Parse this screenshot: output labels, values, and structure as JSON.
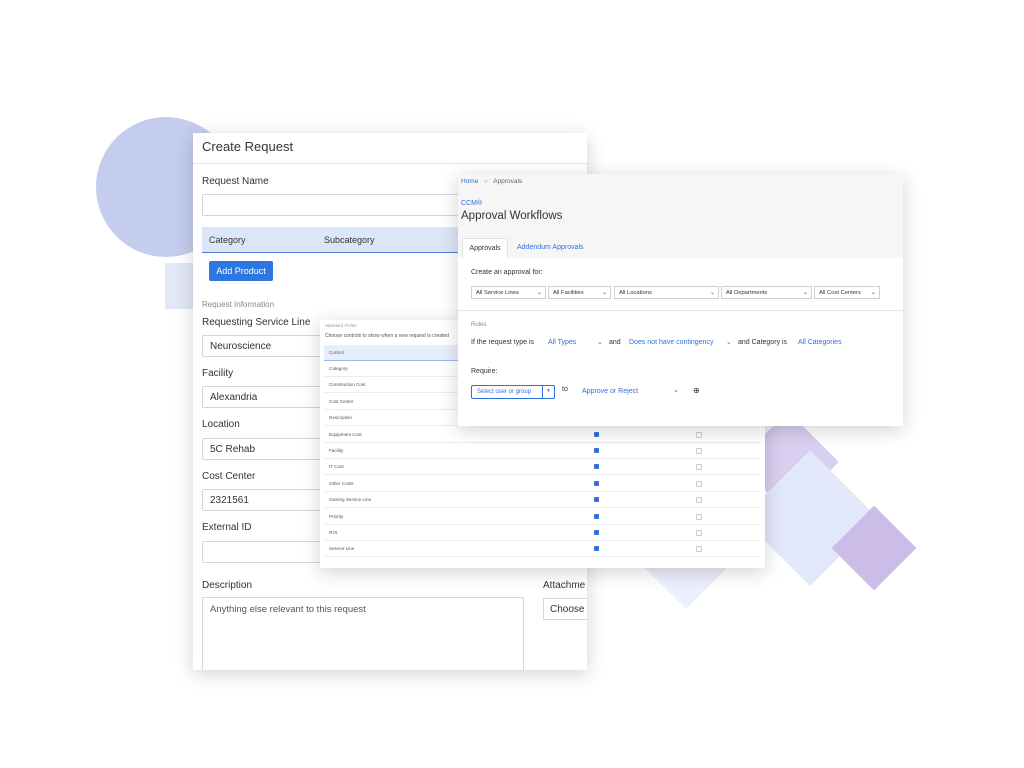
{
  "colors": {
    "accent": "#2f77e0",
    "link": "#2f6fe0",
    "circle": "#c5cdef",
    "diamond_light": "#e6e9fa",
    "diamond_purple": "#cbbde8"
  },
  "create_request": {
    "title": "Create Request",
    "request_name_label": "Request Name",
    "request_name_value": "",
    "table_headers": [
      "Category",
      "Subcategory"
    ],
    "add_product_label": "Add Product",
    "section_label": "Request Information",
    "fields": [
      {
        "label": "Requesting Service Line",
        "value": "Neuroscience"
      },
      {
        "label": "Facility",
        "value": "Alexandria"
      },
      {
        "label": "Location",
        "value": "5C Rehab"
      },
      {
        "label": "Cost Center",
        "value": "2321561"
      },
      {
        "label": "External ID",
        "value": ""
      }
    ],
    "description_label": "Description",
    "description_placeholder": "Anything else relevant to this request",
    "attachments_label": "Attachme",
    "choose_label": "Choose"
  },
  "standard_fields": {
    "title": "Standard Fields",
    "subtitle": "Choose controls to show when a new request is created",
    "header": "Control",
    "rows": [
      {
        "name": "Category"
      },
      {
        "name": "Construction Cost"
      },
      {
        "name": "Cost Center"
      },
      {
        "name": "Description"
      },
      {
        "name": "Equipment Cost",
        "checked": true
      },
      {
        "name": "Facility",
        "checked": true
      },
      {
        "name": "IT Cost",
        "checked": true
      },
      {
        "name": "Other Costs",
        "checked": true
      },
      {
        "name": "Owning Service Line",
        "checked": true
      },
      {
        "name": "Priority",
        "checked": true
      },
      {
        "name": "ROI",
        "checked": true
      },
      {
        "name": "Service Line",
        "checked": true
      }
    ]
  },
  "approvals": {
    "breadcrumb": {
      "home": "Home",
      "sep": "»",
      "current": "Approvals"
    },
    "brand": "CCM®",
    "title": "Approval Workflows",
    "tabs": [
      "Approvals",
      "Addendum Approvals"
    ],
    "create_for_label": "Create an approval for:",
    "filters": [
      "All Service Lines",
      "All Facilities",
      "All Locations",
      "All Departments",
      "All Cost Centers"
    ],
    "rules_label": "Rules",
    "rule": {
      "prefix": "If the request type is",
      "type": "All Types",
      "and": "and",
      "contingency": "Does not have contingency",
      "category_text": "and Category is",
      "category": "All Categories"
    },
    "require_label": "Require:",
    "select_placeholder": "Select user or group",
    "to_label": "to",
    "action": "Approve or Reject"
  }
}
